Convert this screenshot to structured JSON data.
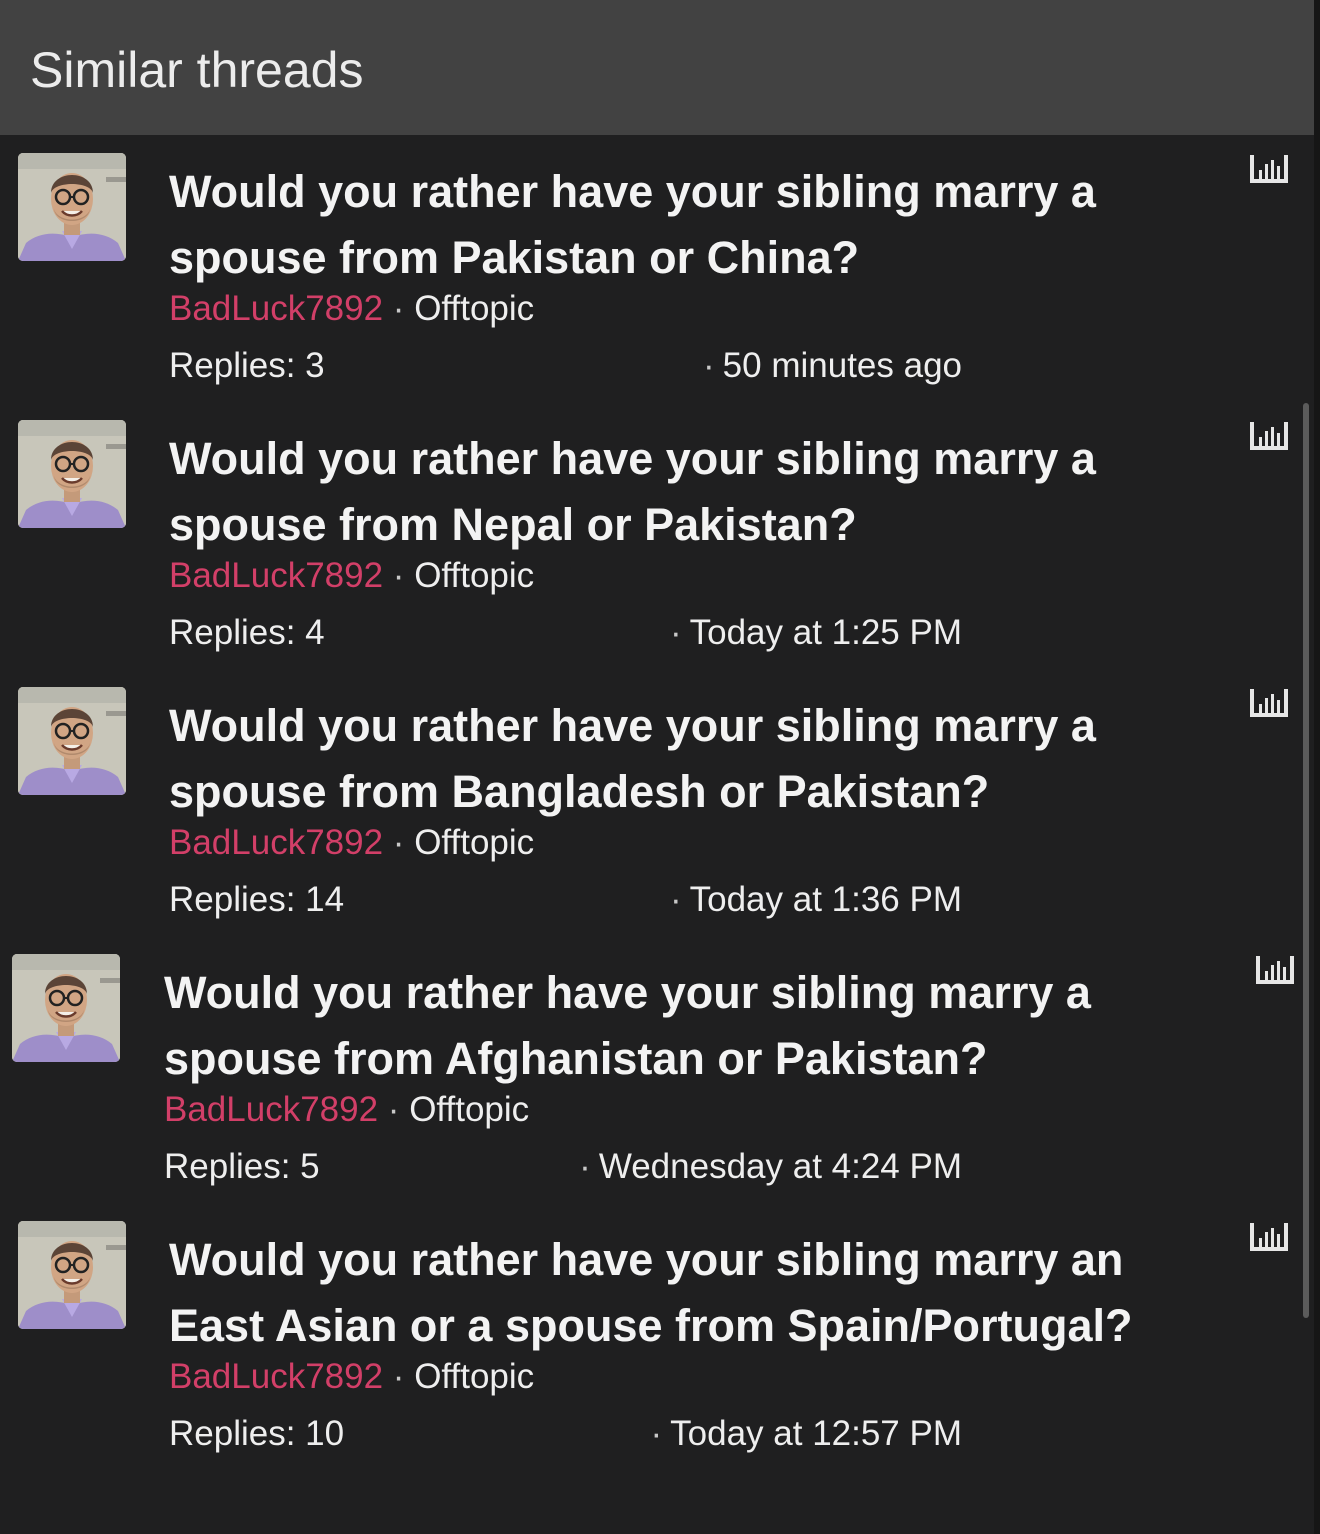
{
  "header": {
    "title": "Similar threads"
  },
  "colors": {
    "background": "#1f1f20",
    "header_background": "#424242",
    "author_link": "#d23f68",
    "text": "#eeeeee"
  },
  "threads": [
    {
      "title": "Would you rather have your sibling marry a spouse from Pakistan or China?",
      "author": "BadLuck7892",
      "separator": " · ",
      "forum": "Offtopic",
      "replies": "Replies: 3",
      "time": "50 minutes ago",
      "avatar_icon": "user-avatar",
      "stats_icon": "bar-chart-icon"
    },
    {
      "title": "Would you rather have your sibling marry a spouse from Nepal or Pakistan?",
      "author": "BadLuck7892",
      "separator": " · ",
      "forum": "Offtopic",
      "replies": "Replies: 4",
      "time": "Today at 1:25 PM",
      "avatar_icon": "user-avatar",
      "stats_icon": "bar-chart-icon"
    },
    {
      "title": "Would you rather have your sibling marry a spouse from Bangladesh or Pakistan?",
      "author": "BadLuck7892",
      "separator": " · ",
      "forum": "Offtopic",
      "replies": "Replies: 14",
      "time": "Today at 1:36 PM",
      "avatar_icon": "user-avatar",
      "stats_icon": "bar-chart-icon"
    },
    {
      "title": "Would you rather have your sibling marry a spouse from Afghanistan or Pakistan?",
      "author": "BadLuck7892",
      "separator": " · ",
      "forum": "Offtopic",
      "replies": "Replies: 5",
      "time": "Wednesday at 4:24 PM",
      "avatar_icon": "user-avatar",
      "stats_icon": "bar-chart-icon"
    },
    {
      "title": "Would you rather have your sibling marry an East Asian or a spouse from Spain/Portugal?",
      "author": "BadLuck7892",
      "separator": " · ",
      "forum": "Offtopic",
      "replies": "Replies: 10",
      "time": "Today at 12:57 PM",
      "avatar_icon": "user-avatar",
      "stats_icon": "bar-chart-icon"
    }
  ]
}
